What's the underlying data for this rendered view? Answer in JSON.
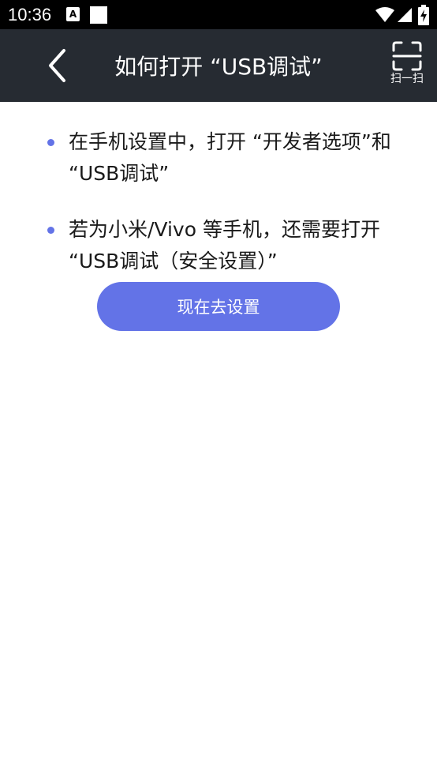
{
  "status_bar": {
    "time": "10:36",
    "notification_letter": "A",
    "icons": [
      "notification-a-icon",
      "notification-square-icon",
      "wifi-icon",
      "signal-icon",
      "battery-charging-icon"
    ]
  },
  "app_bar": {
    "title": "如何打开 “USB调试”",
    "back_icon": "chevron-left-icon",
    "scan_label": "扫一扫",
    "scan_icon": "scan-frame-icon",
    "background": "#262b32"
  },
  "instructions": [
    {
      "text": "在手机设置中，打开 “开发者选项”和 “USB调试”"
    },
    {
      "text": "若为小米/Vivo 等手机，还需要打开 “USB调试（安全设置）”"
    }
  ],
  "action_button": {
    "label": "现在去设置",
    "color": "#6373e7"
  },
  "bullet_color": "#6373e7"
}
